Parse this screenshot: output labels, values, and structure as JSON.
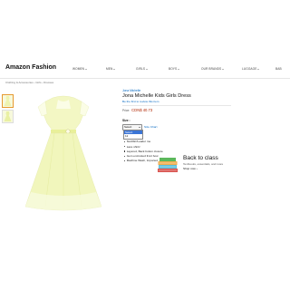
{
  "header": {
    "brand": "Amazon Fashion",
    "nav": [
      {
        "label": "WOMEN"
      },
      {
        "label": "MEN"
      },
      {
        "label": "GIRLS"
      },
      {
        "label": "BOYS"
      },
      {
        "label": "OUR BRANDS"
      },
      {
        "label": "LUGGAGE"
      },
      {
        "label": "BAB"
      }
    ]
  },
  "breadcrumb": "Clothing & Accessories › Girls › Dresses",
  "product": {
    "brand": "Jona Michelle",
    "title": "Jona Michelle Kids Girls Dress",
    "review_link": "Be the first to review this item",
    "price_label": "Price:",
    "price_value": "CDN$ 40.73",
    "size_label": "Size :",
    "size_select": "Select",
    "size_chart": "Size Chart",
    "size_options": [
      "Select",
      "12"
    ],
    "bullets": [
      "color: Yellow",
      "Nonfiltrr/Leader me",
      "Lace shirtz",
      "Layered, Back button closure",
      "Gem encrusted front bow",
      "Machine Wash, Imported"
    ]
  },
  "ad": {
    "title": "Back to class",
    "subtitle": "Textbooks, essentials, and more",
    "link": "Shop now ›"
  },
  "colors": {
    "dress_base": "#f3f7c4",
    "dress_light": "#fbfde6",
    "link": "#0066c0",
    "price": "#b12704",
    "dropdown_highlight": "#3b75d6"
  }
}
